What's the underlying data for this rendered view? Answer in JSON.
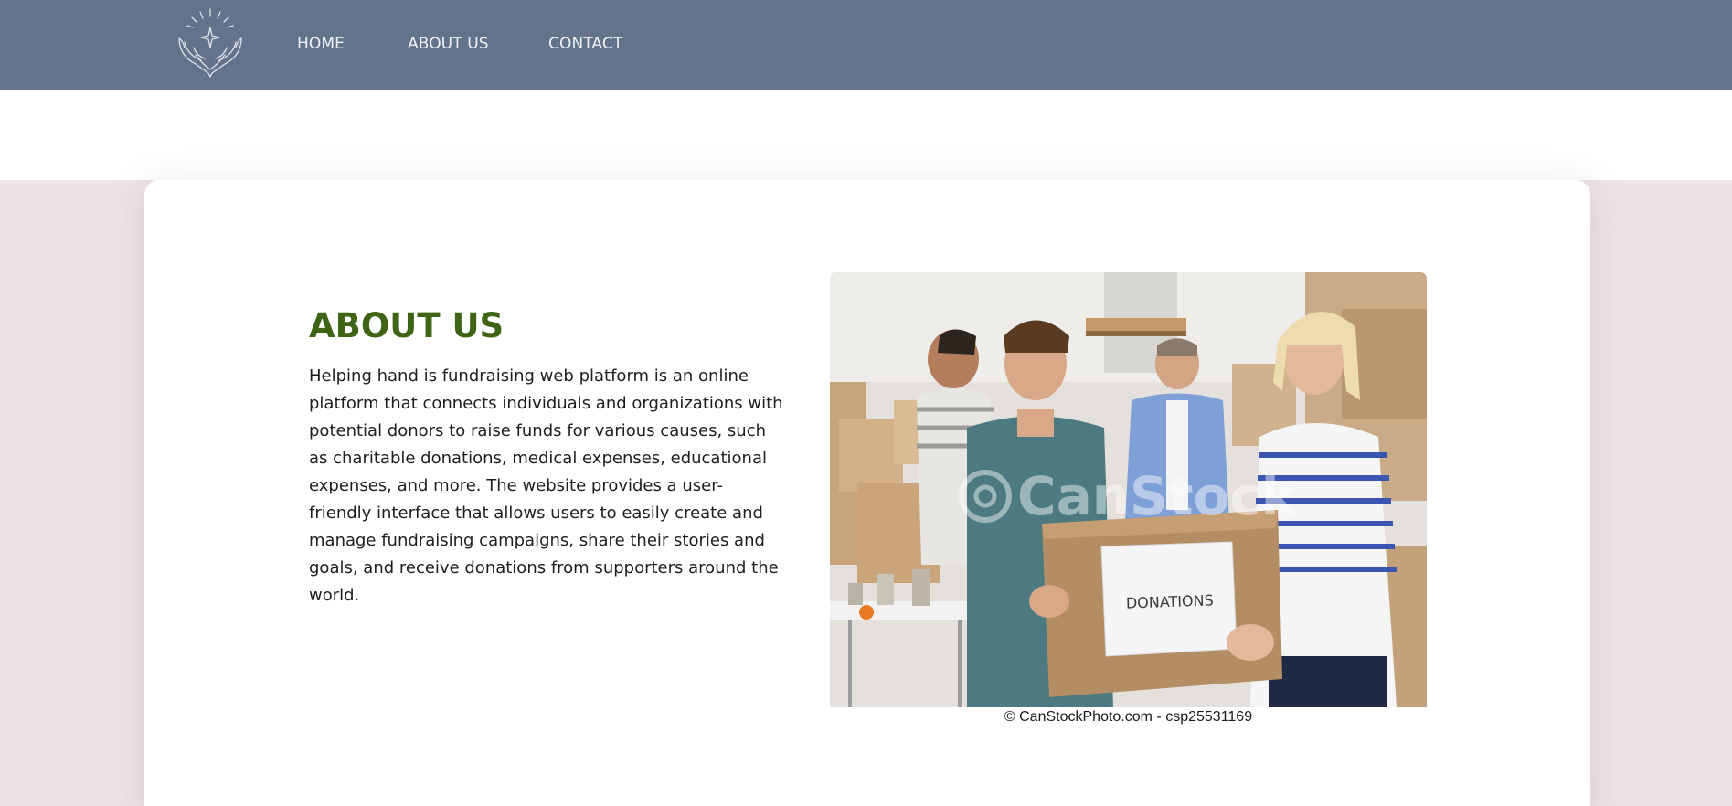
{
  "nav": {
    "logo_icon": "helping-hands-logo",
    "links": [
      {
        "label": "HOME"
      },
      {
        "label": "ABOUT US"
      },
      {
        "label": "CONTACT"
      }
    ]
  },
  "about": {
    "title": "ABOUT US",
    "description": "Helping hand is fundraising web platform is an online platform that connects individuals and organizations with potential donors to raise funds for various causes, such as charitable donations, medical expenses, educational expenses, and more. The website provides a user-friendly interface that allows users to easily create and manage fundraising campaigns, share their stories and goals, and receive donations from supporters around the world."
  },
  "photo": {
    "box_label": "DONATIONS",
    "watermark": "CanStock",
    "credit": "© CanStockPhoto.com - csp25531169"
  },
  "colors": {
    "nav_bg": "#63738b",
    "section_bg": "#eee3e5",
    "title_green": "#3f6416"
  }
}
